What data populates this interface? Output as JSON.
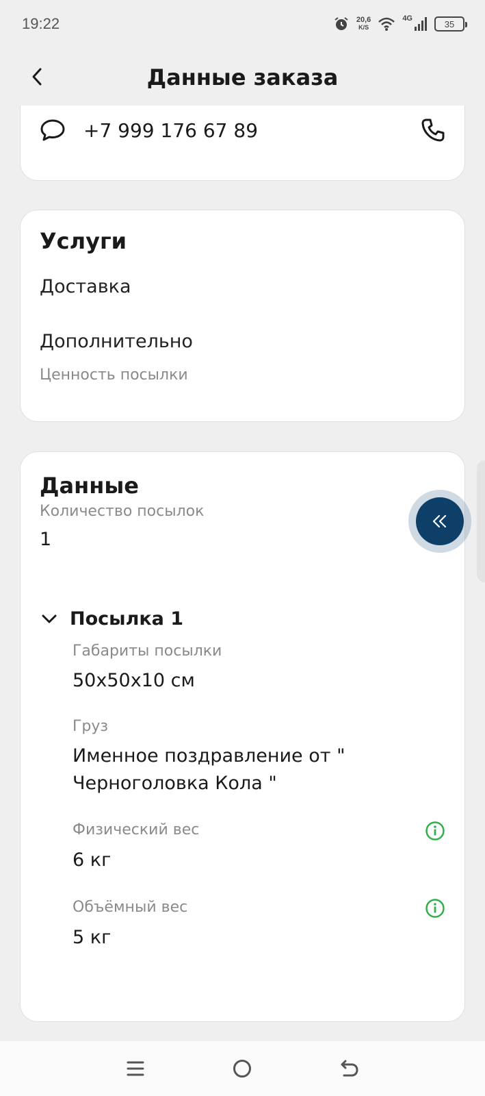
{
  "status_bar": {
    "time": "19:22",
    "speed_value": "20,6",
    "speed_unit": "K/S",
    "network": "4G",
    "battery": "35"
  },
  "header": {
    "title": "Данные заказа"
  },
  "contact": {
    "phone": "+7 999 176 67 89"
  },
  "services": {
    "title": "Услуги",
    "delivery": "Доставка",
    "additional": "Дополнительно",
    "parcel_value": "Ценность посылки"
  },
  "data": {
    "title": "Данные",
    "parcel_count_label": "Количество посылок",
    "parcel_count_value": "1",
    "parcel": {
      "title": "Посылка 1",
      "dimensions_label": "Габариты посылки",
      "dimensions_value": "50x50x10 см",
      "cargo_label": "Груз",
      "cargo_line1": "Именное поздравление от \"",
      "cargo_line2": "Черноголовка Кола \"",
      "physical_weight_label": "Физический вес",
      "physical_weight_value": "6 кг",
      "volume_weight_label": "Объёмный вес",
      "volume_weight_value": "5 кг"
    }
  },
  "colors": {
    "accent": "#0e3f68",
    "info": "#2fb04a",
    "background": "#efefef"
  }
}
